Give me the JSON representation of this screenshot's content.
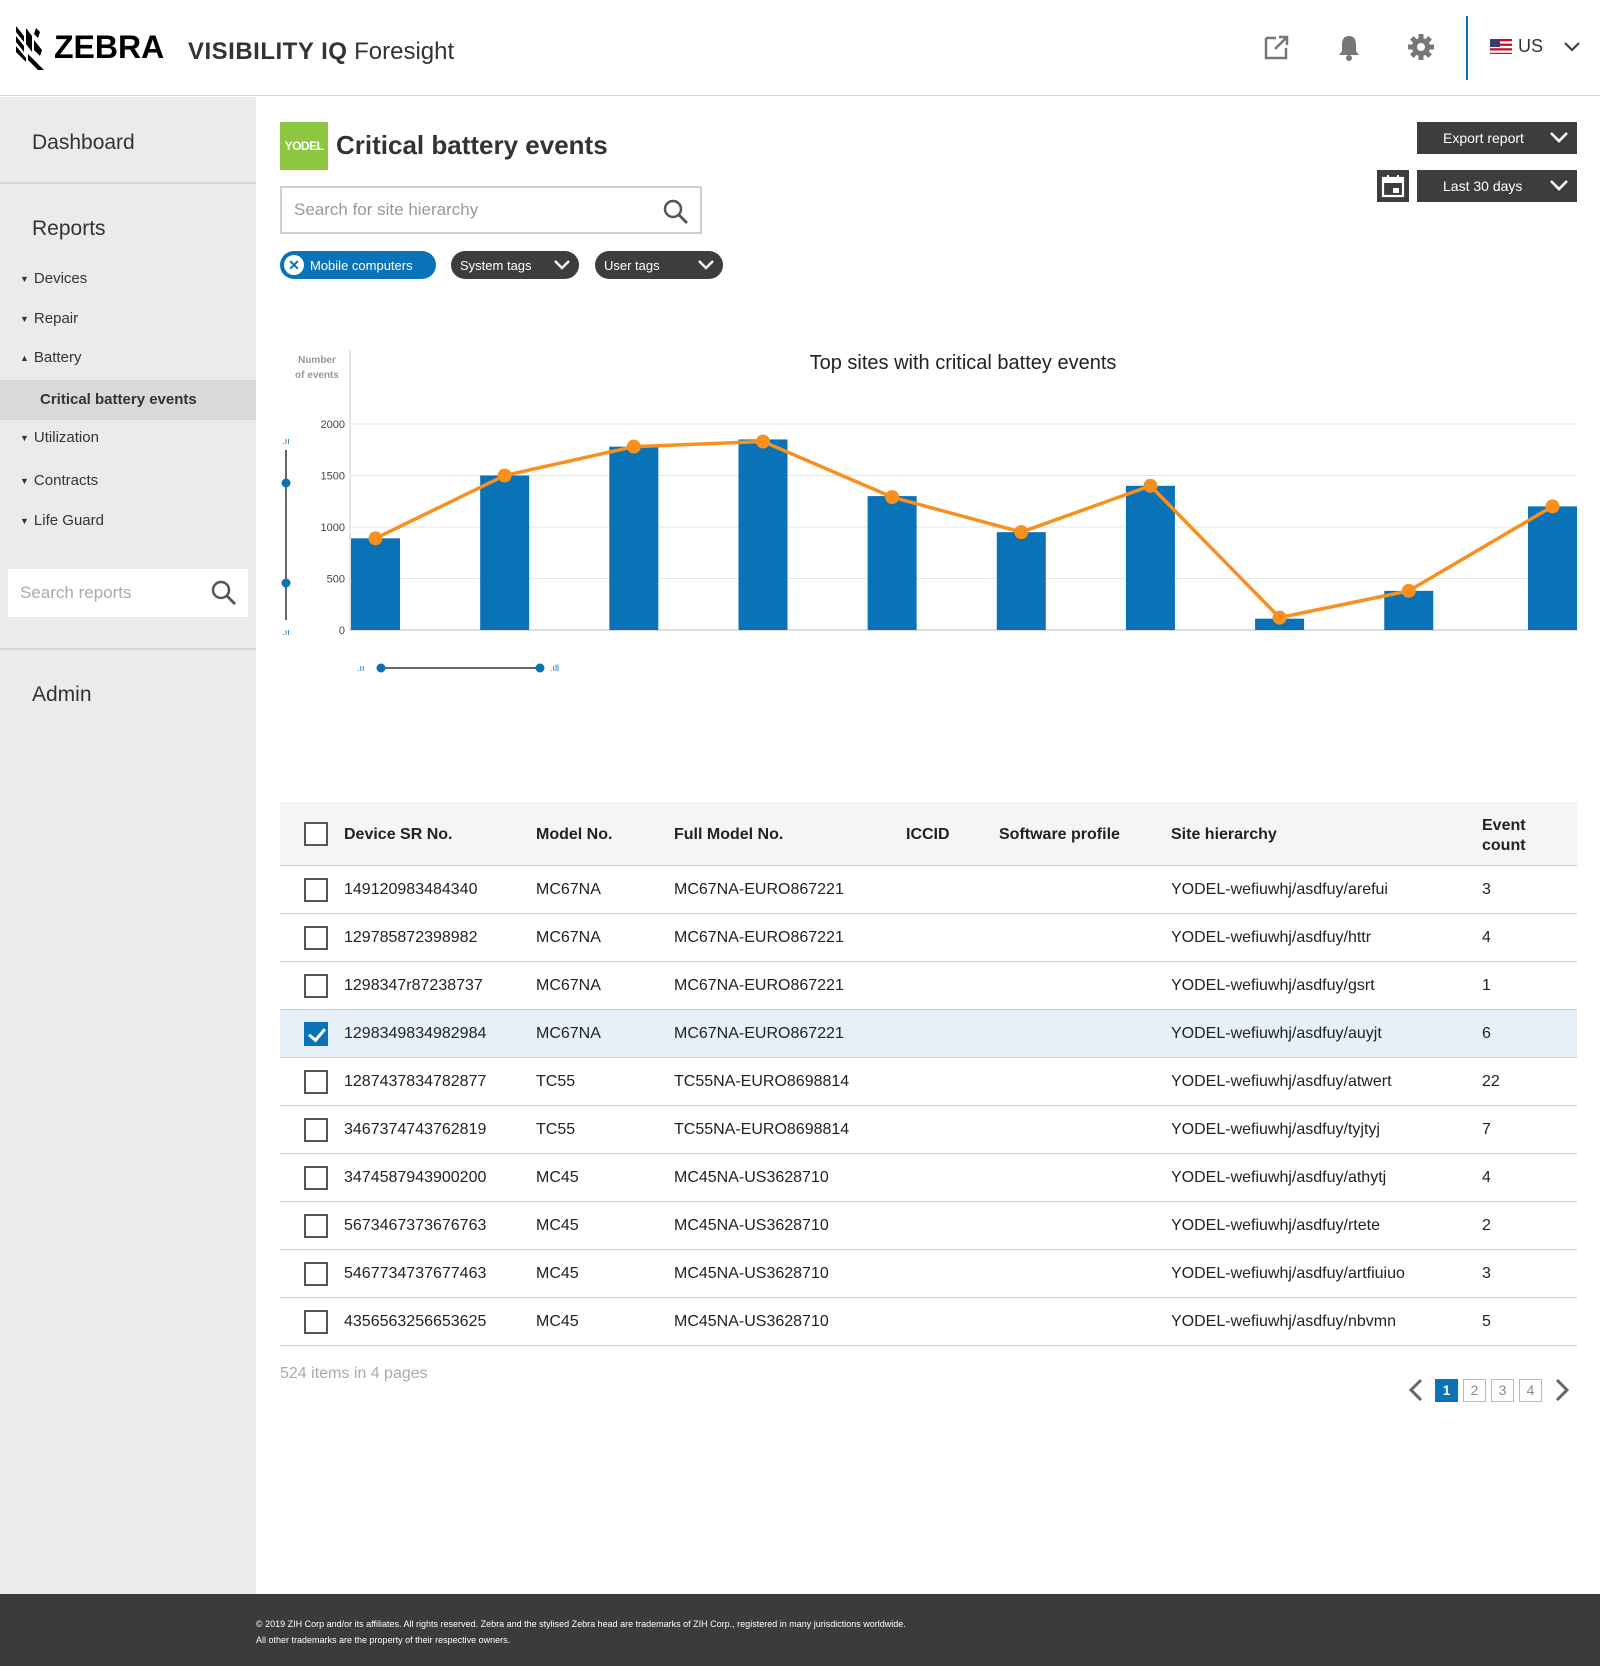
{
  "header": {
    "brand": "ZEBRA",
    "app_name_bold": "VISIBILITY IQ",
    "app_name_rest": " Foresight",
    "locale": "US",
    "icons": [
      "external-link-icon",
      "bell-icon",
      "gear-icon",
      "chevron-down-icon"
    ]
  },
  "sidebar": {
    "dashboard": "Dashboard",
    "reports": "Reports",
    "items": [
      {
        "label": "Devices",
        "state": "collapsed"
      },
      {
        "label": "Repair",
        "state": "collapsed"
      },
      {
        "label": "Battery",
        "state": "expanded"
      },
      {
        "label": "Utilization",
        "state": "collapsed"
      },
      {
        "label": "Contracts",
        "state": "collapsed"
      },
      {
        "label": "Life Guard",
        "state": "collapsed"
      }
    ],
    "active_sub_item": "Critical battery events",
    "search_placeholder": "Search reports",
    "admin": "Admin"
  },
  "main": {
    "brand_badge": "YODEL",
    "title": "Critical battery events",
    "site_search_placeholder": "Search for site hierarchy",
    "filters": {
      "active_chip": "Mobile computers",
      "system_tags": "System tags",
      "user_tags": "User tags"
    },
    "export_button": "Export report",
    "date_range": "Last 30 days"
  },
  "colors": {
    "accent": "#0a73b8",
    "line": "#f7901e",
    "brand_badge": "#8dc63f",
    "dark_button": "#3d3d3d",
    "selected_row": "#e5f0f8"
  },
  "chart_data": {
    "type": "bar",
    "title": "Top sites with critical battey events",
    "ylabel": "Number of events",
    "ylabel_lines": [
      "Number",
      "of events"
    ],
    "ylim": [
      0,
      2000
    ],
    "yticks": [
      0,
      500,
      1000,
      1500,
      2000
    ],
    "grid": true,
    "series": [
      {
        "type": "bar",
        "values": [
          890,
          1500,
          1780,
          1850,
          1300,
          950,
          1400,
          110,
          380,
          1200
        ]
      },
      {
        "type": "line",
        "values": [
          890,
          1500,
          1780,
          1830,
          1290,
          950,
          1400,
          120,
          380,
          1200
        ]
      }
    ]
  },
  "table": {
    "columns": [
      "Device SR No.",
      "Model No.",
      "Full Model No.",
      "ICCID",
      "Software profile",
      "Site hierarchy",
      "Event count"
    ],
    "event_count_lines": [
      "Event",
      "count"
    ],
    "rows": [
      {
        "sr": "149120983484340",
        "model": "MC67NA",
        "full_model": "MC67NA-EURO867221",
        "iccid": "",
        "profile": "",
        "site": "YODEL-wefiuwhj/asdfuy/arefui",
        "count": "3",
        "checked": false
      },
      {
        "sr": "129785872398982",
        "model": "MC67NA",
        "full_model": "MC67NA-EURO867221",
        "iccid": "",
        "profile": "",
        "site": "YODEL-wefiuwhj/asdfuy/httr",
        "count": "4",
        "checked": false
      },
      {
        "sr": "1298347r87238737",
        "model": "MC67NA",
        "full_model": "MC67NA-EURO867221",
        "iccid": "",
        "profile": "",
        "site": "YODEL-wefiuwhj/asdfuy/gsrt",
        "count": "1",
        "checked": false
      },
      {
        "sr": "1298349834982984",
        "model": "MC67NA",
        "full_model": "MC67NA-EURO867221",
        "iccid": "",
        "profile": "",
        "site": "YODEL-wefiuwhj/asdfuy/auyjt",
        "count": "6",
        "checked": true
      },
      {
        "sr": "1287437834782877",
        "model": "TC55",
        "full_model": "TC55NA-EURO8698814",
        "iccid": "",
        "profile": "",
        "site": "YODEL-wefiuwhj/asdfuy/atwert",
        "count": "22",
        "checked": false
      },
      {
        "sr": "3467374743762819",
        "model": "TC55",
        "full_model": "TC55NA-EURO8698814",
        "iccid": "",
        "profile": "",
        "site": "YODEL-wefiuwhj/asdfuy/tyjtyj",
        "count": "7",
        "checked": false
      },
      {
        "sr": "3474587943900200",
        "model": "MC45",
        "full_model": "MC45NA-US3628710",
        "iccid": "",
        "profile": "",
        "site": "YODEL-wefiuwhj/asdfuy/athytj",
        "count": "4",
        "checked": false
      },
      {
        "sr": "5673467373676763",
        "model": "MC45",
        "full_model": "MC45NA-US3628710",
        "iccid": "",
        "profile": "",
        "site": "YODEL-wefiuwhj/asdfuy/rtete",
        "count": "2",
        "checked": false
      },
      {
        "sr": "5467734737677463",
        "model": "MC45",
        "full_model": "MC45NA-US3628710",
        "iccid": "",
        "profile": "",
        "site": "YODEL-wefiuwhj/asdfuy/artfiuiuo",
        "count": "3",
        "checked": false
      },
      {
        "sr": "4356563256653625",
        "model": "MC45",
        "full_model": "MC45NA-US3628710",
        "iccid": "",
        "profile": "",
        "site": "YODEL-wefiuwhj/asdfuy/nbvmn",
        "count": "5",
        "checked": false
      }
    ]
  },
  "pagination": {
    "summary": "524 items in 4 pages",
    "pages": [
      "1",
      "2",
      "3",
      "4"
    ],
    "current": "1"
  },
  "footer": {
    "line1": "© 2019 ZIH Corp and/or its affiliates. All rights reserved. Zebra and the stylised Zebra head are trademarks of ZIH Corp., registered in many jurisdictions worldwide.",
    "line2": "All other trademarks are the property of their respective owners."
  }
}
